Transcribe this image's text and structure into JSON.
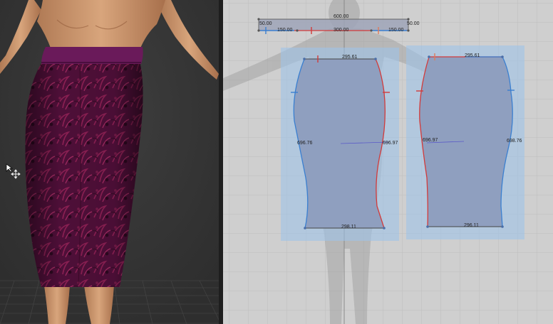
{
  "app": {
    "accent_color": "#3a7fd0",
    "seam_color": "#d23a3a",
    "pattern_fill": "#8f9fbf",
    "selection_fill": "#9ec3e8",
    "fabric_color": "#5a1440"
  },
  "viewport3d": {
    "cursor_icon": "move-cursor-icon",
    "garment": "pencil skirt with purple waistband"
  },
  "waistband": {
    "total_length": "600.00",
    "left_end": "50.00",
    "right_end": "50.00",
    "seg_left": "150.00",
    "seg_mid": "300.00",
    "seg_right": "150.00"
  },
  "front_panel": {
    "top": "295.61",
    "side_left": "696.76",
    "side_right": "696.97",
    "hem": "298.11"
  },
  "back_panel": {
    "top": "295.61",
    "side_left": "696.97",
    "side_right": "698.76",
    "hem": "296.11"
  }
}
